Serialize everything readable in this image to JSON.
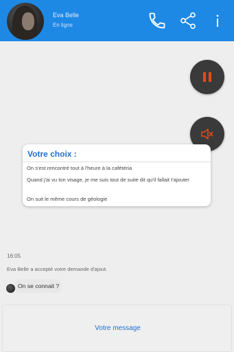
{
  "header": {
    "contact_name": "Eva Belle",
    "contact_status": "En ligne",
    "background_color": "#1e88e5",
    "icons": [
      "phone-icon",
      "share-icon",
      "more-icon"
    ]
  },
  "controls": {
    "pause_icon": "pause-icon",
    "mute_icon": "speaker-mute-icon",
    "accent_color": "#e64a19"
  },
  "choice_dialog": {
    "title": "Votre choix :",
    "options": [
      "On s'est rencontré tout à l'heure à la cafétéria",
      "Quand j'ai vu ton visage, je me suis tout de suite dit qu'il fallait t'ajouter",
      "On suit le même cours de géologie"
    ]
  },
  "chat": {
    "time": "16:05",
    "system_message": "Eva Belle a accepté votre demande d'ajout.",
    "messages": [
      {
        "text": "On se connait ?"
      }
    ]
  },
  "input": {
    "placeholder": "Votre message"
  }
}
